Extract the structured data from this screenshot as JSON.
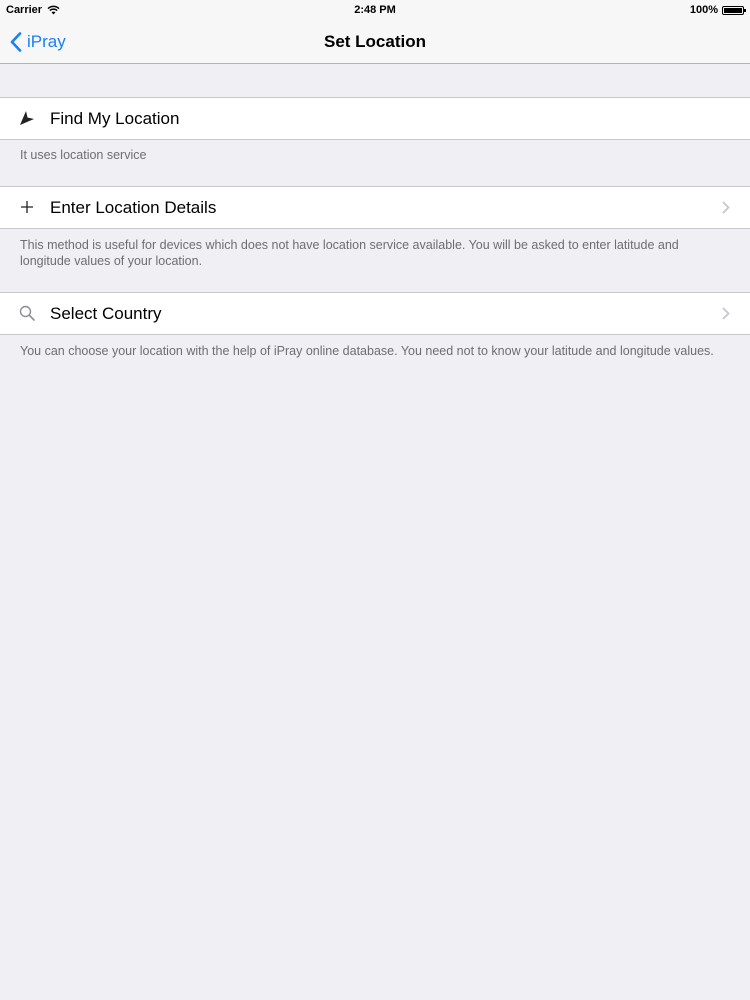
{
  "status_bar": {
    "carrier": "Carrier",
    "time": "2:48 PM",
    "battery": "100%"
  },
  "nav": {
    "back_label": "iPray",
    "title": "Set Location"
  },
  "rows": [
    {
      "label": "Find My Location",
      "icon": "location-arrow-icon",
      "footer": "It uses location service",
      "has_chevron": false
    },
    {
      "label": "Enter Location Details",
      "icon": "plus-icon",
      "footer": "This method is useful for devices which does not have location service available. You will be asked to enter latitude and longitude values of your location.",
      "has_chevron": true
    },
    {
      "label": "Select Country",
      "icon": "search-icon",
      "footer": "You can choose your location with the help of iPray online database. You need not to know your latitude and longitude values.",
      "has_chevron": true
    }
  ],
  "colors": {
    "accent": "#1a7ff5",
    "background": "#efeff4",
    "footer_text": "#6d6d72"
  }
}
